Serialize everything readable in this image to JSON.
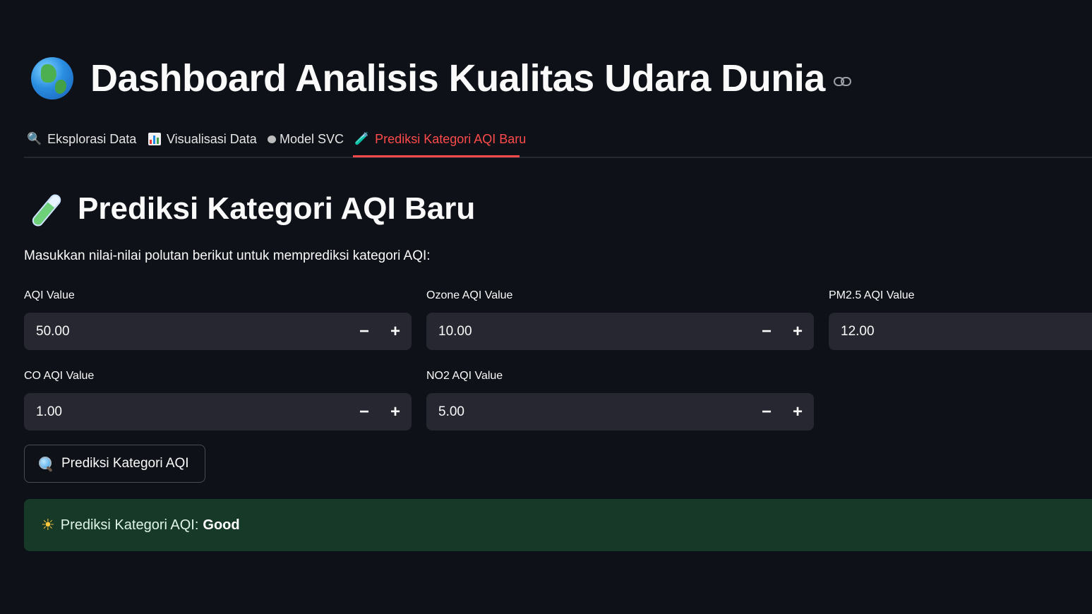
{
  "header": {
    "title": "Dashboard Analisis Kualitas Udara Dunia",
    "title_icon": "globe-icon",
    "anchor_icon": "link-icon"
  },
  "tabs": [
    {
      "label": "Eksplorasi Data",
      "icon": "magnifier-icon",
      "active": false
    },
    {
      "label": "Visualisasi Data",
      "icon": "bar-chart-icon",
      "active": false
    },
    {
      "label": "Model SVC",
      "icon": "brain-icon",
      "active": false
    },
    {
      "label": "Prediksi Kategori AQI Baru",
      "icon": "test-tube-icon",
      "active": true
    }
  ],
  "section": {
    "title": "Prediksi Kategori AQI Baru",
    "icon": "test-tube-icon",
    "intro": "Masukkan nilai-nilai polutan berikut untuk memprediksi kategori AQI:"
  },
  "inputs": [
    {
      "label": "AQI Value",
      "value": "50.00"
    },
    {
      "label": "Ozone AQI Value",
      "value": "10.00"
    },
    {
      "label": "PM2.5 AQI Value",
      "value": "12.00"
    },
    {
      "label": "CO AQI Value",
      "value": "1.00"
    },
    {
      "label": "NO2 AQI Value",
      "value": "5.00"
    }
  ],
  "stepper": {
    "minus": "−",
    "plus": "+"
  },
  "predict_button": {
    "label": "Prediksi Kategori AQI",
    "icon": "magnifier-icon"
  },
  "result": {
    "icon": "sun-icon",
    "prefix": "Prediksi Kategori AQI:",
    "value": "Good"
  },
  "colors": {
    "background": "#0e1117",
    "accent": "#ff4b4b",
    "input_bg": "#262730",
    "success_bg": "#173928"
  }
}
